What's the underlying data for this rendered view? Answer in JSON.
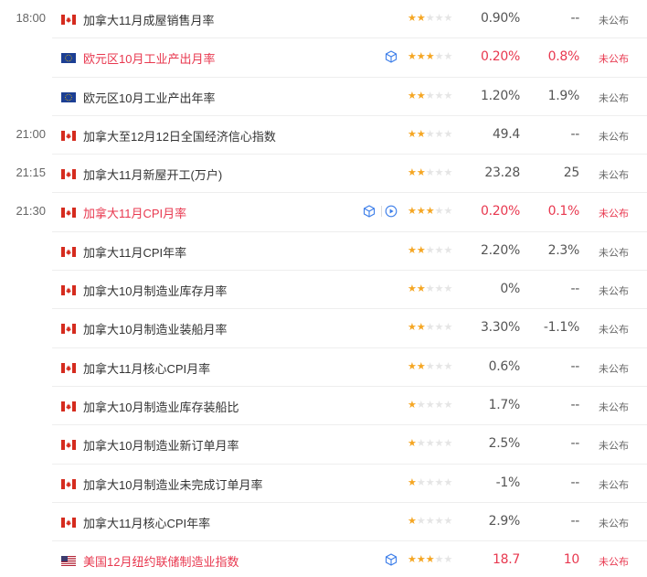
{
  "rows": [
    {
      "time": "18:00",
      "flag": "ca",
      "name": "加拿大11月成屋销售月率",
      "stars": 2,
      "actual": "0.90%",
      "previous": "--",
      "status": "未公布",
      "highlight": false,
      "icons": []
    },
    {
      "time": "",
      "flag": "eu",
      "name": "欧元区10月工业产出月率",
      "stars": 3,
      "actual": "0.20%",
      "previous": "0.8%",
      "status": "未公布",
      "highlight": true,
      "icons": [
        "cube"
      ]
    },
    {
      "time": "",
      "flag": "eu",
      "name": "欧元区10月工业产出年率",
      "stars": 2,
      "actual": "1.20%",
      "previous": "1.9%",
      "status": "未公布",
      "highlight": false,
      "icons": []
    },
    {
      "time": "21:00",
      "flag": "ca",
      "name": "加拿大至12月12日全国经济信心指数",
      "stars": 2,
      "actual": "49.4",
      "previous": "--",
      "status": "未公布",
      "highlight": false,
      "icons": []
    },
    {
      "time": "21:15",
      "flag": "ca",
      "name": "加拿大11月新屋开工(万户)",
      "stars": 2,
      "actual": "23.28",
      "previous": "25",
      "status": "未公布",
      "highlight": false,
      "icons": []
    },
    {
      "time": "21:30",
      "flag": "ca",
      "name": "加拿大11月CPI月率",
      "stars": 3,
      "actual": "0.20%",
      "previous": "0.1%",
      "status": "未公布",
      "highlight": true,
      "icons": [
        "cube",
        "play"
      ]
    },
    {
      "time": "",
      "flag": "ca",
      "name": "加拿大11月CPI年率",
      "stars": 2,
      "actual": "2.20%",
      "previous": "2.3%",
      "status": "未公布",
      "highlight": false,
      "icons": []
    },
    {
      "time": "",
      "flag": "ca",
      "name": "加拿大10月制造业库存月率",
      "stars": 2,
      "actual": "0%",
      "previous": "--",
      "status": "未公布",
      "highlight": false,
      "icons": []
    },
    {
      "time": "",
      "flag": "ca",
      "name": "加拿大10月制造业装船月率",
      "stars": 2,
      "actual": "3.30%",
      "previous": "-1.1%",
      "status": "未公布",
      "highlight": false,
      "icons": []
    },
    {
      "time": "",
      "flag": "ca",
      "name": "加拿大11月核心CPI月率",
      "stars": 2,
      "actual": "0.6%",
      "previous": "--",
      "status": "未公布",
      "highlight": false,
      "icons": []
    },
    {
      "time": "",
      "flag": "ca",
      "name": "加拿大10月制造业库存装船比",
      "stars": 1,
      "actual": "1.7%",
      "previous": "--",
      "status": "未公布",
      "highlight": false,
      "icons": []
    },
    {
      "time": "",
      "flag": "ca",
      "name": "加拿大10月制造业新订单月率",
      "stars": 1,
      "actual": "2.5%",
      "previous": "--",
      "status": "未公布",
      "highlight": false,
      "icons": []
    },
    {
      "time": "",
      "flag": "ca",
      "name": "加拿大10月制造业未完成订单月率",
      "stars": 1,
      "actual": "-1%",
      "previous": "--",
      "status": "未公布",
      "highlight": false,
      "icons": []
    },
    {
      "time": "",
      "flag": "ca",
      "name": "加拿大11月核心CPI年率",
      "stars": 1,
      "actual": "2.9%",
      "previous": "--",
      "status": "未公布",
      "highlight": false,
      "icons": []
    },
    {
      "time": "",
      "flag": "us",
      "name": "美国12月纽约联储制造业指数",
      "stars": 3,
      "actual": "18.7",
      "previous": "10",
      "status": "未公布",
      "highlight": true,
      "icons": [
        "cube"
      ]
    }
  ],
  "colors": {
    "highlight": "#e8384f",
    "star_on": "#f5a623",
    "star_off": "#e5e5e5",
    "icon_blue": "#3b7de9"
  }
}
